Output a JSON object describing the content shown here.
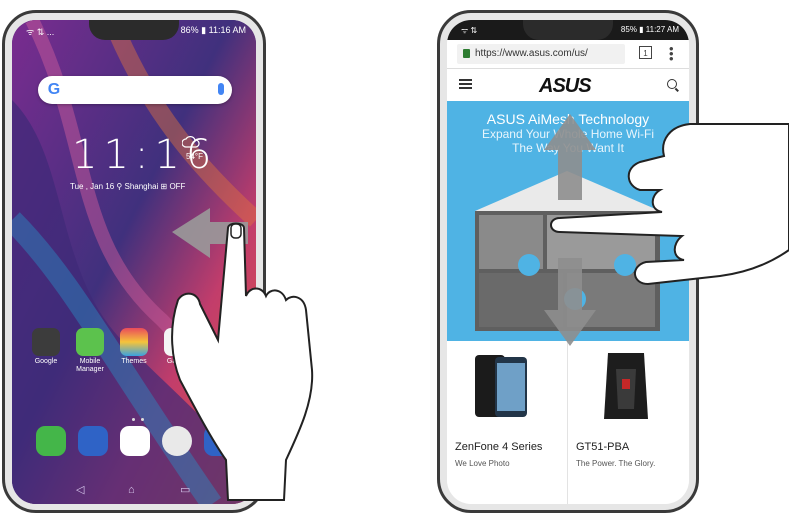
{
  "left_phone": {
    "status": {
      "left": "ᯤ ⇅ ...",
      "right": "86% ▮ 11:16 AM"
    },
    "clock": "11:16",
    "weather": {
      "temp": "54°F"
    },
    "date": "Tue , Jan 16  ⚲ Shanghai  ⊞ OFF",
    "apps": [
      {
        "label": "Google",
        "color": "#3c3c3c"
      },
      {
        "label": "Mobile\nManager",
        "color": "#5cc24d"
      },
      {
        "label": "Themes",
        "color": "#f2a33c"
      },
      {
        "label": "Gallery",
        "color": "#f4f4f4"
      }
    ],
    "dock": [
      {
        "name": "phone",
        "color": "#44b649"
      },
      {
        "name": "messages",
        "color": "#2f63c6"
      },
      {
        "name": "play-store",
        "color": "#ffffff"
      },
      {
        "name": "chrome",
        "color": "#e9e9e9"
      },
      {
        "name": "app",
        "color": "#2f63c6"
      }
    ],
    "nav": {
      "back": "◁",
      "home": "⌂",
      "recents": "▭"
    }
  },
  "right_phone": {
    "status": {
      "left": "ᯤ ⇅",
      "right": "85% ▮ 11:27 AM"
    },
    "url": "https://www.asus.com/us/",
    "tab_count": "1",
    "logo": "ASUS",
    "hero": {
      "line1": "ASUS AiMesh Technology",
      "line2": "Expand Your Whole Home Wi-Fi",
      "line3": "The Way You Want It"
    },
    "products": [
      {
        "name": "ZenFone 4 Series",
        "tag": "We Love Photo"
      },
      {
        "name": "GT51-PBA",
        "tag": "The Power. The Glory."
      }
    ]
  },
  "colors": {
    "accent": "#4fb3e4",
    "frame": "#3a3a3a"
  }
}
